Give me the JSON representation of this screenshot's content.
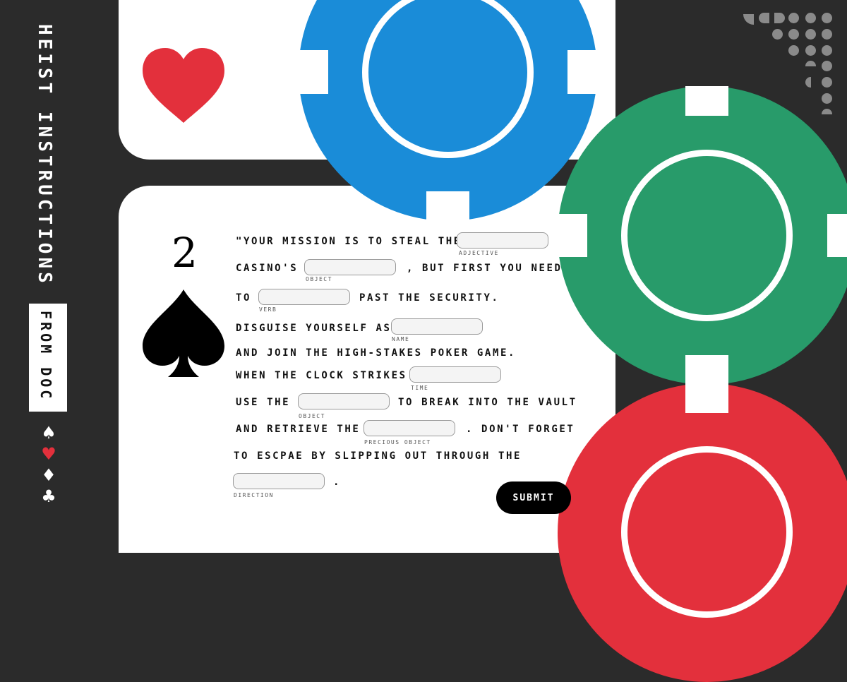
{
  "sidebar": {
    "title": "HEIST INSTRUCTIONS",
    "badge": "FROM DOC",
    "suits": [
      "♠",
      "♥",
      "♦",
      "♣"
    ]
  },
  "card": {
    "rank": "2"
  },
  "colors": {
    "chip_blue": "#1a8cd8",
    "chip_green": "#289b6a",
    "chip_red": "#e3303c",
    "heart": "#e3303c",
    "background": "#2b2b2b"
  },
  "form": {
    "lines": {
      "l1": "\"YOUR MISSION IS TO STEAL THE",
      "l2a": "CASINO'S",
      "l2b": ", BUT FIRST YOU NEED",
      "l3a": "TO",
      "l3b": "PAST THE SECURITY.",
      "l4": "DISGUISE YOURSELF AS",
      "l5": "AND JOIN THE HIGH-STAKES POKER GAME.",
      "l6": "WHEN THE CLOCK STRIKES",
      "l7a": "USE THE",
      "l7b": "TO BREAK INTO THE VAULT",
      "l8a": "AND RETRIEVE THE",
      "l8b": ". DON'T FORGET",
      "l9": "TO ESCPAE BY SLIPPING OUT THROUGH THE",
      "l10": "."
    },
    "fields": [
      {
        "label": "ADJECTIVE",
        "value": ""
      },
      {
        "label": "OBJECT",
        "value": ""
      },
      {
        "label": "VERB",
        "value": ""
      },
      {
        "label": "NAME",
        "value": ""
      },
      {
        "label": "TIME",
        "value": ""
      },
      {
        "label": "OBJECT",
        "value": ""
      },
      {
        "label": "PRECIOUS OBJECT",
        "value": ""
      },
      {
        "label": "DIRECTION",
        "value": ""
      }
    ],
    "submit_label": "SUBMIT"
  }
}
